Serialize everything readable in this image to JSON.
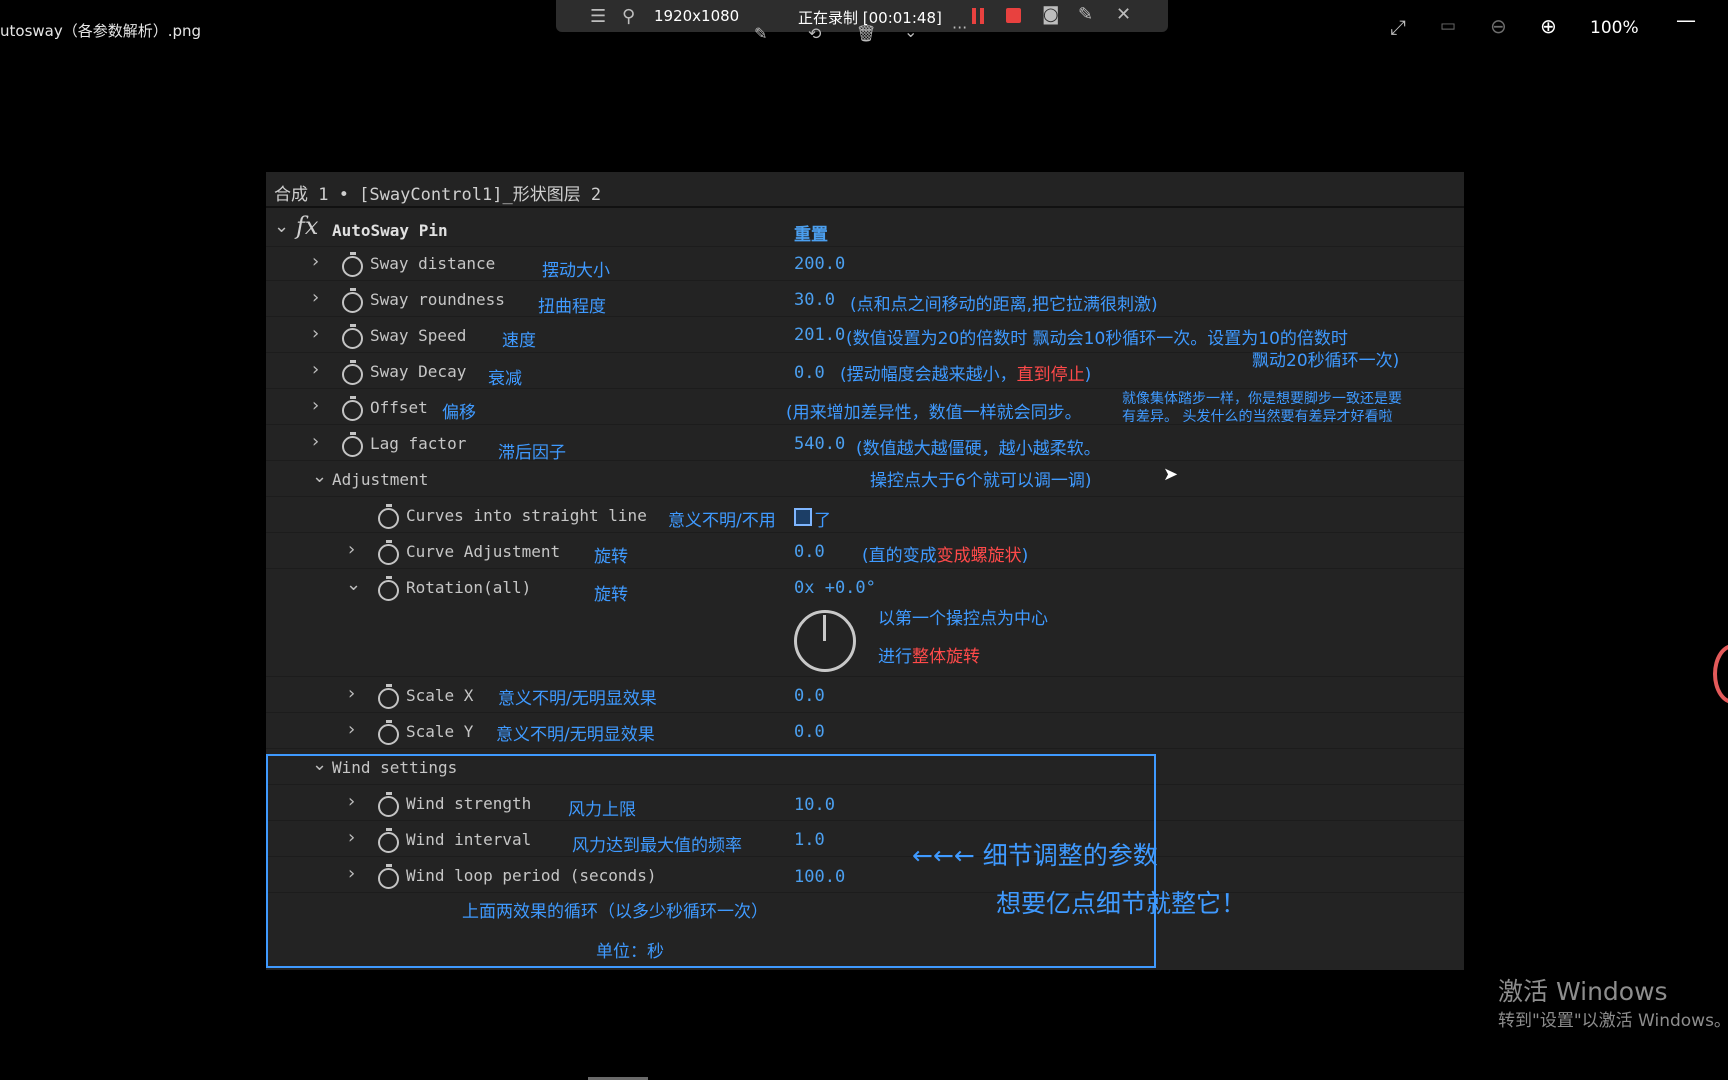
{
  "viewer": {
    "file_title": "utosway（各参数解析）.png",
    "zoom_level": "100%"
  },
  "recording_bar": {
    "resolution": "1920x1080",
    "status": "正在录制 [00:01:48]"
  },
  "panel": {
    "header": "合成 1 • [SwayControl1]_形状图层 2",
    "effect_name": "AutoSway Pin",
    "reset_label": "重置"
  },
  "rows": {
    "sway_distance": {
      "label": "Sway distance",
      "note": "摆动大小",
      "value": "200.0"
    },
    "sway_roundness": {
      "label": "Sway roundness",
      "note": "扭曲程度",
      "value": "30.0",
      "comment": "(点和点之间移动的距离,把它拉满很刺激)"
    },
    "sway_speed": {
      "label": "Sway Speed",
      "note": "速度",
      "value": "201.0",
      "comment": "(数值设置为20的倍数时 飘动会10秒循环一次。设置为10的倍数时",
      "comment2": "飘动20秒循环一次)"
    },
    "sway_decay": {
      "label": "Sway Decay",
      "note": "衰减",
      "value": "0.0",
      "comment": "(摆动幅度会越来越小，",
      "comment_red": "直到停止",
      "comment_end": ")"
    },
    "offset": {
      "label": "Offset",
      "note": "偏移",
      "comment": "(用来增加差异性，数值一样就会同步。",
      "comment_small1": "就像集体踏步一样，你是想要脚步一致还是要",
      "comment_small2": "有差异。    头发什么的当然要有差异才好看啦"
    },
    "lag_factor": {
      "label": "Lag factor",
      "note": "滞后因子",
      "value": "540.0",
      "comment": "(数值越大越僵硬，越小越柔软。",
      "comment2": "操控点大于6个就可以调一调)"
    },
    "adjustment": {
      "label": "Adjustment"
    },
    "curves_straight": {
      "label": "Curves into straight line",
      "note_a": "意义不明/不用",
      "note_b": "了"
    },
    "curve_adjustment": {
      "label": "Curve Adjustment",
      "note": "旋转",
      "value": "0.0",
      "comment": "(直的变成",
      "comment_red": "变成螺旋状",
      "comment_end": ")"
    },
    "rotation_all": {
      "label": "Rotation(all)",
      "note": "旋转",
      "value": "0x +0.0°",
      "comment": "以第一个操控点为中心",
      "comment2": "进行",
      "comment2_red": "整体旋转"
    },
    "scale_x": {
      "label": "Scale X",
      "note": "意义不明/无明显效果",
      "value": "0.0"
    },
    "scale_y": {
      "label": "Scale Y",
      "note": "意义不明/无明显效果",
      "value": "0.0"
    },
    "wind_settings": {
      "label": "Wind settings"
    },
    "wind_strength": {
      "label": "Wind strength",
      "note": "风力上限",
      "value": "10.0"
    },
    "wind_interval": {
      "label": "Wind interval",
      "note": "风力达到最大值的频率",
      "value": "1.0"
    },
    "wind_loop": {
      "label": "Wind loop period (seconds)",
      "value": "100.0",
      "comment": "上面两效果的循环（以多少秒循环一次）",
      "comment2": "单位：秒"
    }
  },
  "annotations": {
    "arrow_note": "←←← 细节调整的参数",
    "tip_note": "想要亿点细节就整它！"
  },
  "watermark": {
    "title": "激活 Windows",
    "subtitle": "转到\"设置\"以激活 Windows。"
  },
  "colors": {
    "accent_blue": "#3f9aff",
    "highlight_red": "#ff4a4a",
    "record_red": "#e8413f",
    "panel_bg": "#232323"
  }
}
